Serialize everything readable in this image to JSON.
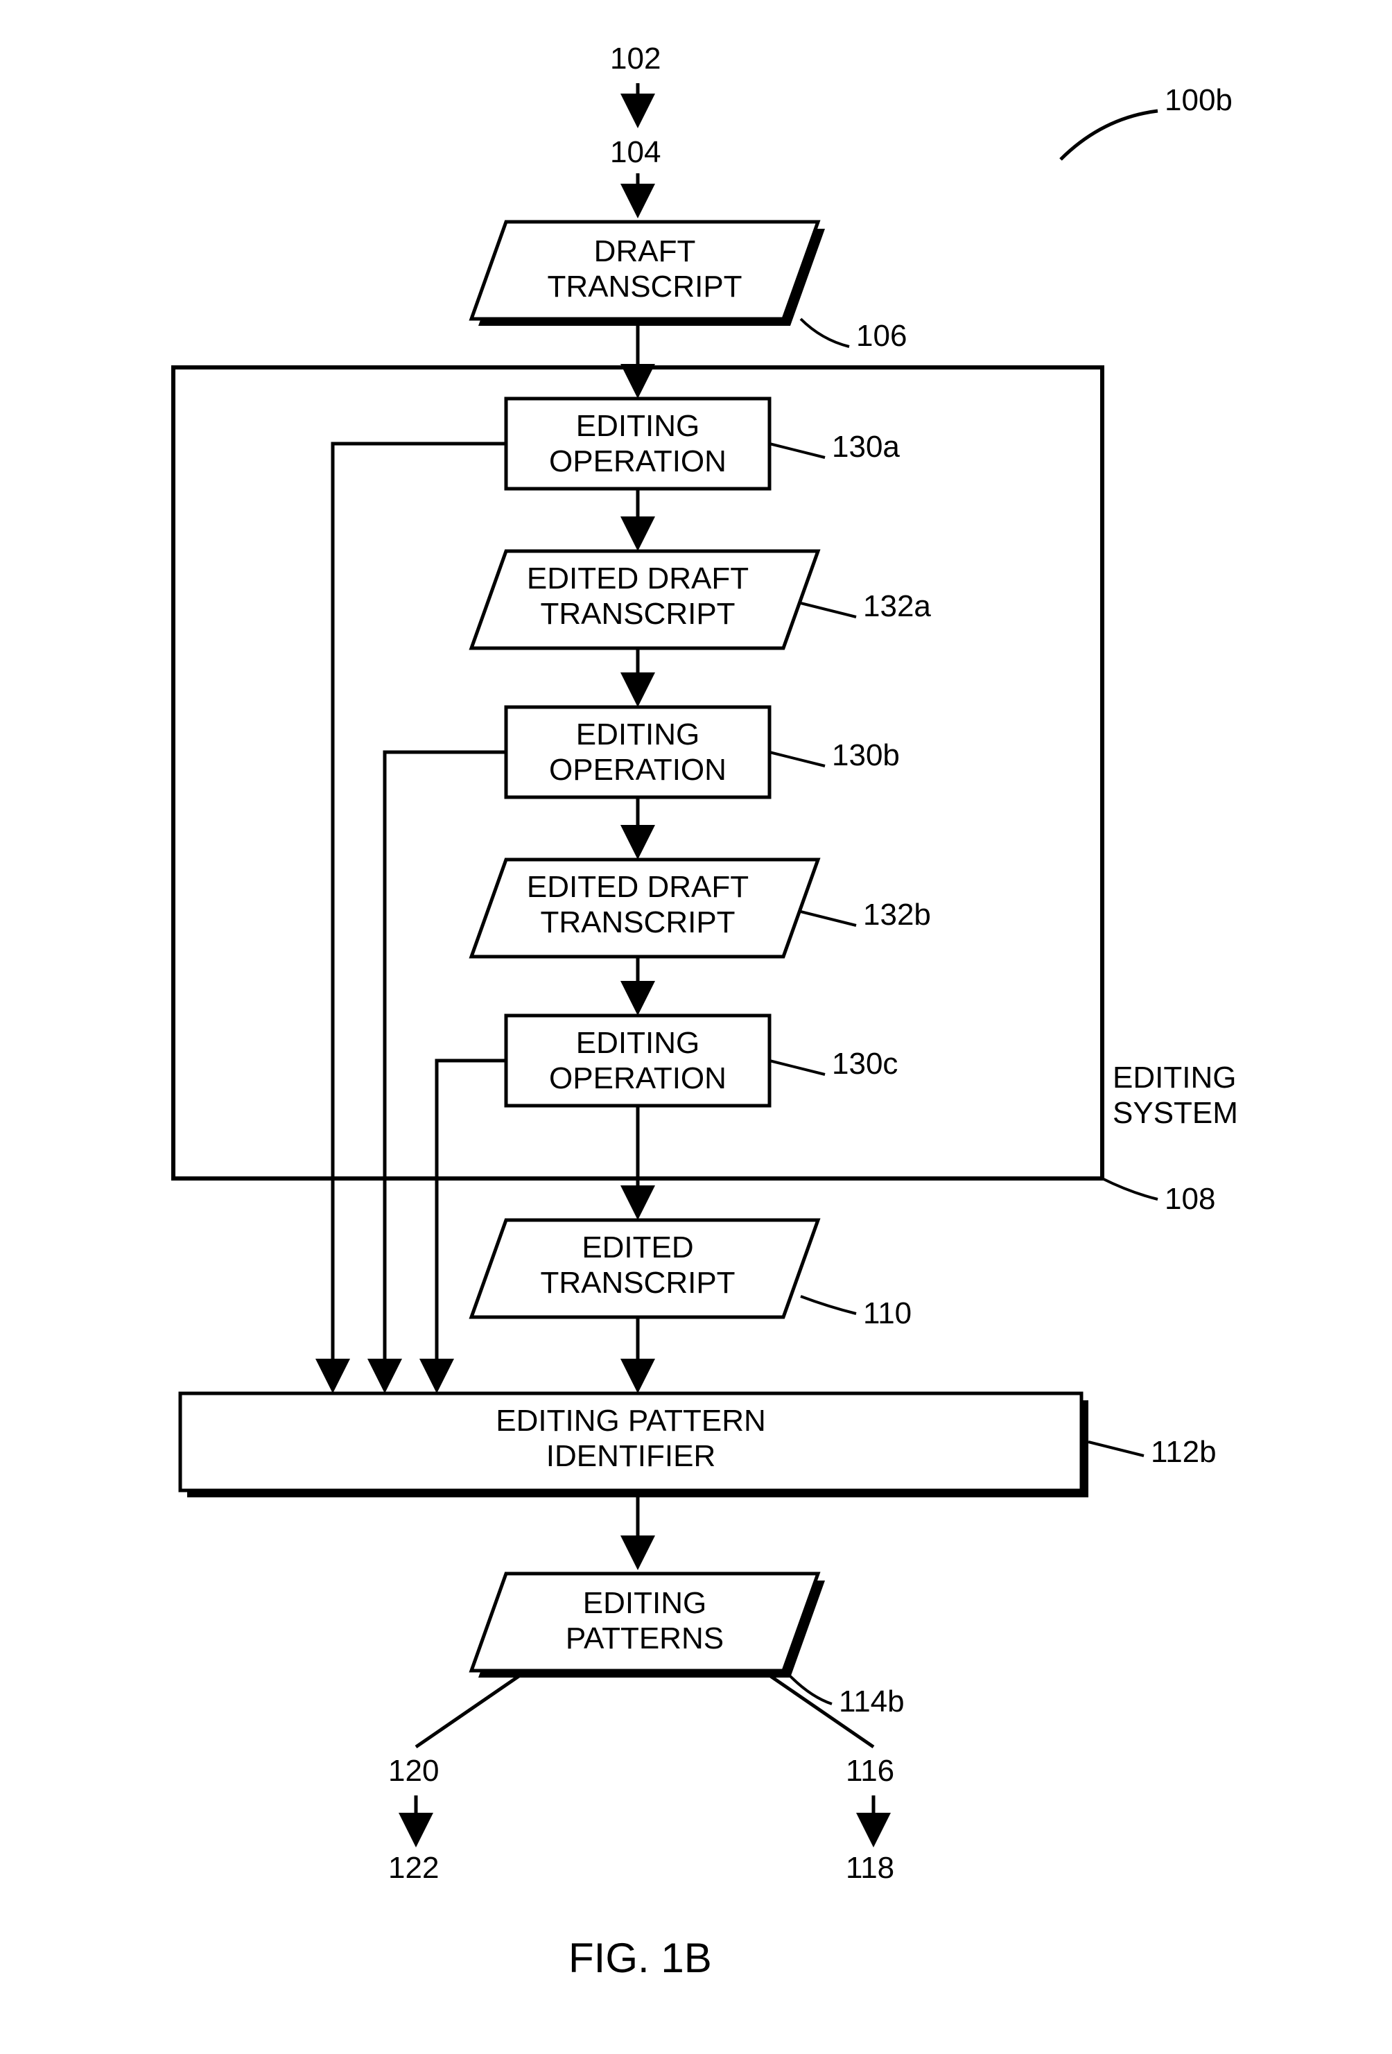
{
  "figure": {
    "caption": "FIG. 1B",
    "system_ref": "100b",
    "editing_system_label": "EDITING\nSYSTEM",
    "editing_system_ref": "108"
  },
  "top_inputs": {
    "ref1": "102",
    "ref2": "104"
  },
  "blocks": {
    "draft_transcript": {
      "text": "DRAFT\nTRANSCRIPT",
      "ref": "106"
    },
    "edit_op_a": {
      "text": "EDITING\nOPERATION",
      "ref": "130a"
    },
    "edited_draft_a": {
      "text": "EDITED DRAFT\nTRANSCRIPT",
      "ref": "132a"
    },
    "edit_op_b": {
      "text": "EDITING\nOPERATION",
      "ref": "130b"
    },
    "edited_draft_b": {
      "text": "EDITED DRAFT\nTRANSCRIPT",
      "ref": "132b"
    },
    "edit_op_c": {
      "text": "EDITING\nOPERATION",
      "ref": "130c"
    },
    "edited_transcript": {
      "text": "EDITED\nTRANSCRIPT",
      "ref": "110"
    },
    "pattern_identifier": {
      "text": "EDITING PATTERN\nIDENTIFIER",
      "ref": "112b"
    },
    "editing_patterns": {
      "text": "EDITING\nPATTERNS",
      "ref": "114b"
    }
  },
  "bottom_outputs": {
    "left1": "120",
    "left2": "122",
    "right1": "116",
    "right2": "118"
  },
  "chart_data": {
    "type": "flowchart",
    "title": "FIG. 1B",
    "nodes": [
      {
        "id": "102",
        "label": "102",
        "shape": "reference"
      },
      {
        "id": "104",
        "label": "104",
        "shape": "reference"
      },
      {
        "id": "106",
        "label": "DRAFT TRANSCRIPT",
        "shape": "parallelogram",
        "ref": "106"
      },
      {
        "id": "130a",
        "label": "EDITING OPERATION",
        "shape": "rectangle",
        "ref": "130a"
      },
      {
        "id": "132a",
        "label": "EDITED DRAFT TRANSCRIPT",
        "shape": "parallelogram",
        "ref": "132a"
      },
      {
        "id": "130b",
        "label": "EDITING OPERATION",
        "shape": "rectangle",
        "ref": "130b"
      },
      {
        "id": "132b",
        "label": "EDITED DRAFT TRANSCRIPT",
        "shape": "parallelogram",
        "ref": "132b"
      },
      {
        "id": "130c",
        "label": "EDITING OPERATION",
        "shape": "rectangle",
        "ref": "130c"
      },
      {
        "id": "110",
        "label": "EDITED TRANSCRIPT",
        "shape": "parallelogram",
        "ref": "110"
      },
      {
        "id": "112b",
        "label": "EDITING PATTERN IDENTIFIER",
        "shape": "rectangle",
        "ref": "112b"
      },
      {
        "id": "114b",
        "label": "EDITING PATTERNS",
        "shape": "parallelogram",
        "ref": "114b"
      },
      {
        "id": "120",
        "label": "120",
        "shape": "reference"
      },
      {
        "id": "122",
        "label": "122",
        "shape": "reference"
      },
      {
        "id": "116",
        "label": "116",
        "shape": "reference"
      },
      {
        "id": "118",
        "label": "118",
        "shape": "reference"
      },
      {
        "id": "108",
        "label": "EDITING SYSTEM",
        "shape": "container",
        "ref": "108",
        "contains": [
          "130a",
          "132a",
          "130b",
          "132b",
          "130c"
        ]
      },
      {
        "id": "100b",
        "label": "100b",
        "shape": "reference"
      }
    ],
    "edges": [
      {
        "from": "102",
        "to": "104"
      },
      {
        "from": "104",
        "to": "106"
      },
      {
        "from": "106",
        "to": "130a"
      },
      {
        "from": "130a",
        "to": "132a"
      },
      {
        "from": "132a",
        "to": "130b"
      },
      {
        "from": "130b",
        "to": "132b"
      },
      {
        "from": "132b",
        "to": "130c"
      },
      {
        "from": "130c",
        "to": "110"
      },
      {
        "from": "110",
        "to": "112b"
      },
      {
        "from": "130a",
        "to": "112b"
      },
      {
        "from": "130b",
        "to": "112b"
      },
      {
        "from": "130c",
        "to": "112b"
      },
      {
        "from": "112b",
        "to": "114b"
      },
      {
        "from": "114b",
        "to": "120"
      },
      {
        "from": "120",
        "to": "122"
      },
      {
        "from": "114b",
        "to": "116"
      },
      {
        "from": "116",
        "to": "118"
      }
    ]
  }
}
